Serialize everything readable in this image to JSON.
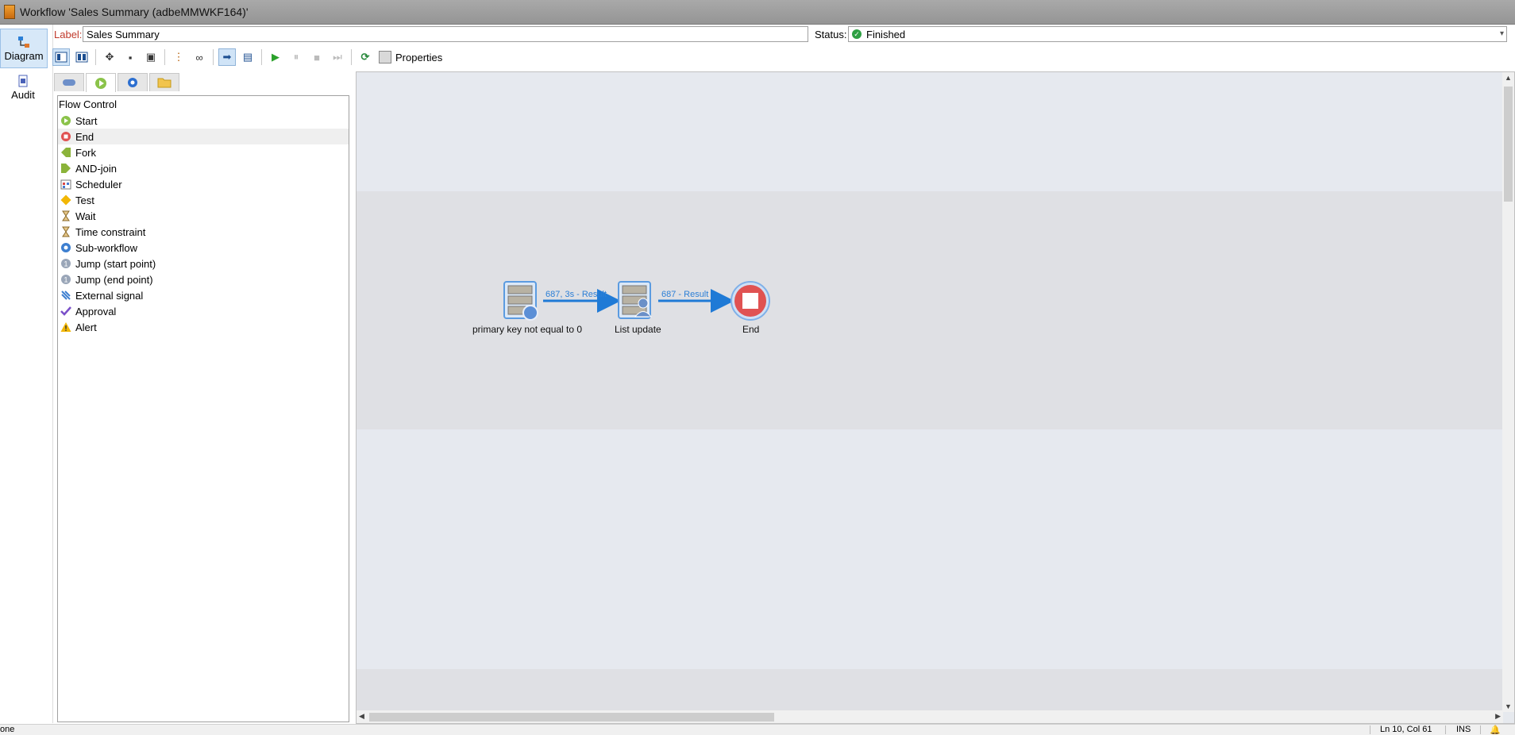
{
  "window": {
    "title": "Workflow 'Sales Summary (adbeMMWKF164)'"
  },
  "nav": {
    "diagram": "Diagram",
    "audit": "Audit"
  },
  "form": {
    "label_caption": "Label:",
    "label_value": "Sales Summary",
    "status_caption": "Status:",
    "status_value": "Finished"
  },
  "toolbar": {
    "properties": "Properties"
  },
  "palette": {
    "header": "Flow Control",
    "items": [
      {
        "label": "Start",
        "icon": "start-icon"
      },
      {
        "label": "End",
        "icon": "end-icon"
      },
      {
        "label": "Fork",
        "icon": "fork-icon"
      },
      {
        "label": "AND-join",
        "icon": "and-join-icon"
      },
      {
        "label": "Scheduler",
        "icon": "scheduler-icon"
      },
      {
        "label": "Test",
        "icon": "test-icon"
      },
      {
        "label": "Wait",
        "icon": "hourglass-icon"
      },
      {
        "label": "Time constraint",
        "icon": "hourglass-icon"
      },
      {
        "label": "Sub-workflow",
        "icon": "sub-workflow-icon"
      },
      {
        "label": "Jump (start point)",
        "icon": "jump-icon"
      },
      {
        "label": "Jump (end point)",
        "icon": "jump-icon"
      },
      {
        "label": "External signal",
        "icon": "external-signal-icon"
      },
      {
        "label": "Approval",
        "icon": "checkmark-icon"
      },
      {
        "label": "Alert",
        "icon": "warning-icon"
      }
    ]
  },
  "diagram": {
    "nodes": [
      {
        "label": "primary key not equal to 0",
        "icon": "query-icon"
      },
      {
        "label": "List update",
        "icon": "list-update-icon"
      },
      {
        "label": "End",
        "icon": "end-icon"
      }
    ],
    "transitions": [
      {
        "label": "687, 3s - Result"
      },
      {
        "label": "687 - Result"
      }
    ]
  },
  "statusbar": {
    "left": "one",
    "position": "Ln 10, Col 61",
    "mode": "INS"
  },
  "colors": {
    "accent": "#1f7ad6",
    "end_node": "#e05252",
    "selection": "#d7e8f8",
    "status_ok": "#2ea043"
  }
}
